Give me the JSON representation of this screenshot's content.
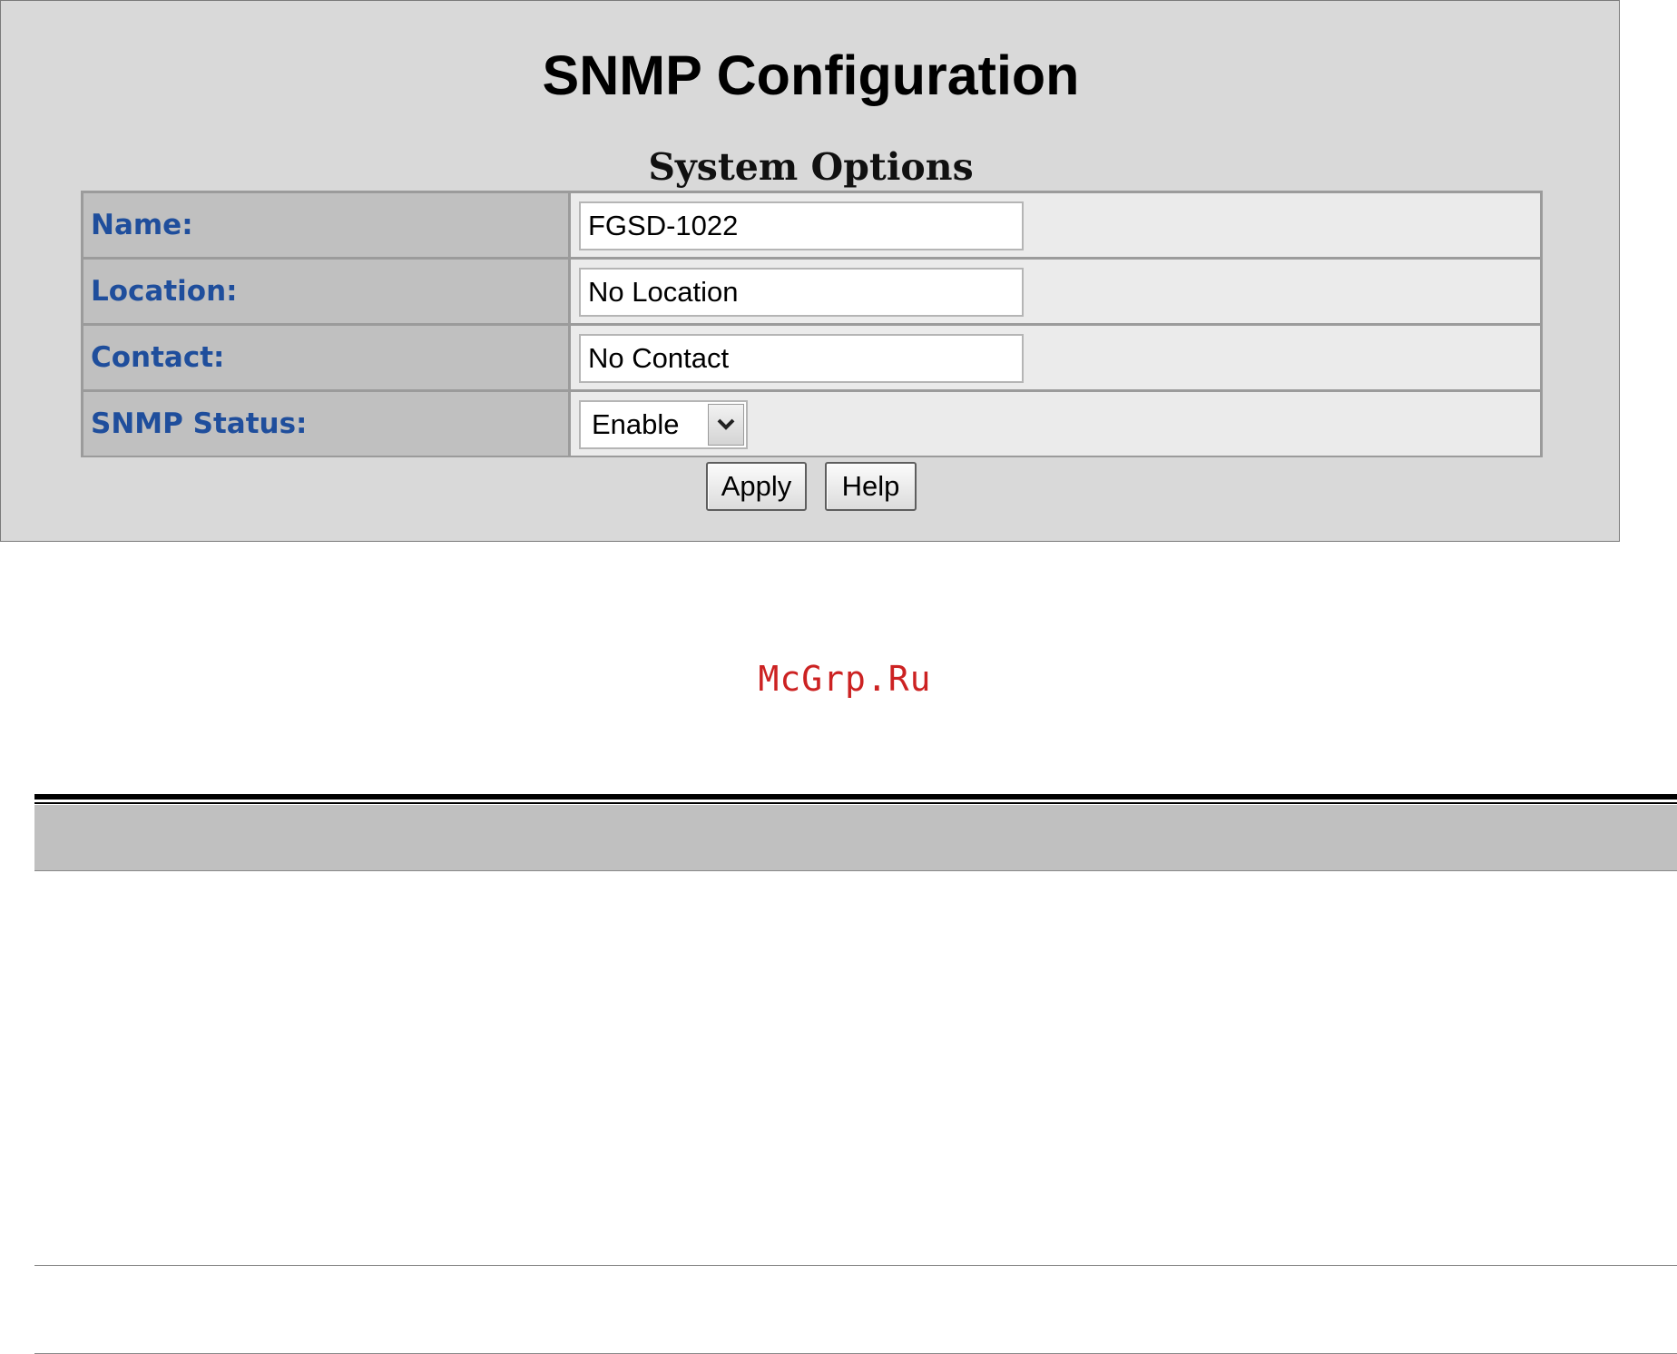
{
  "page": {
    "title": "SNMP Configuration",
    "section_title": "System Options"
  },
  "options": [
    {
      "label": "Name:",
      "type": "text",
      "value": "FGSD-1022"
    },
    {
      "label": "Location:",
      "type": "text",
      "value": "No Location"
    },
    {
      "label": "Contact:",
      "type": "text",
      "value": "No Contact"
    },
    {
      "label": "SNMP Status:",
      "type": "select",
      "value": "Enable"
    }
  ],
  "buttons": {
    "apply": "Apply",
    "help": "Help"
  },
  "watermark": "McGrp.Ru",
  "icons": {
    "dropdown": "chevron-down-icon"
  },
  "colors": {
    "panel_bg": "#d9d9d9",
    "label_cell_bg": "#c0c0c0",
    "value_cell_bg": "#ebebeb",
    "label_text": "#1f4e9c",
    "watermark": "#cc2222"
  }
}
